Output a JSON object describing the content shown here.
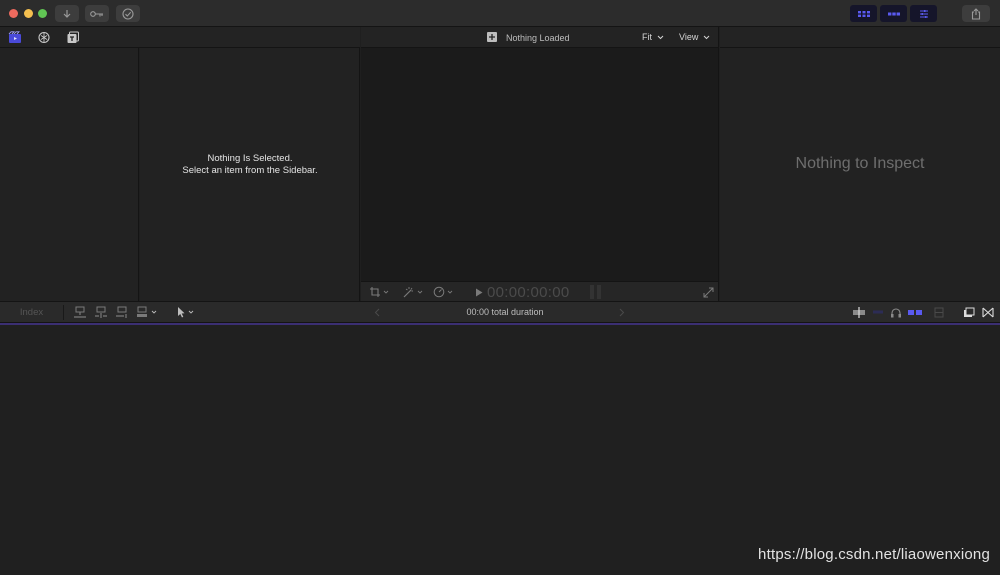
{
  "titlebar": {
    "buttons": [
      "import",
      "keywords",
      "background-tasks"
    ],
    "workspaces": [
      "libraries-workspace",
      "timeline-workspace",
      "inspector-workspace"
    ],
    "colors": {
      "traffic_close": "#ed6a5e",
      "traffic_min": "#f4bf4f",
      "traffic_max": "#61c554",
      "accent": "#5a5af0"
    }
  },
  "browser": {
    "icons": [
      "libraries-icon",
      "photos-audio-icon",
      "titles-generators-icon"
    ],
    "empty_line1": "Nothing Is Selected.",
    "empty_line2": "Select an item from the Sidebar."
  },
  "viewer": {
    "status": "Nothing Loaded",
    "fit_label": "Fit",
    "view_label": "View",
    "timecode": "00:00:00:00"
  },
  "inspector": {
    "empty_message": "Nothing to Inspect"
  },
  "timeline": {
    "index_label": "Index",
    "duration": "00:00 total duration"
  },
  "watermark": "https://blog.csdn.net/liaowenxiong"
}
